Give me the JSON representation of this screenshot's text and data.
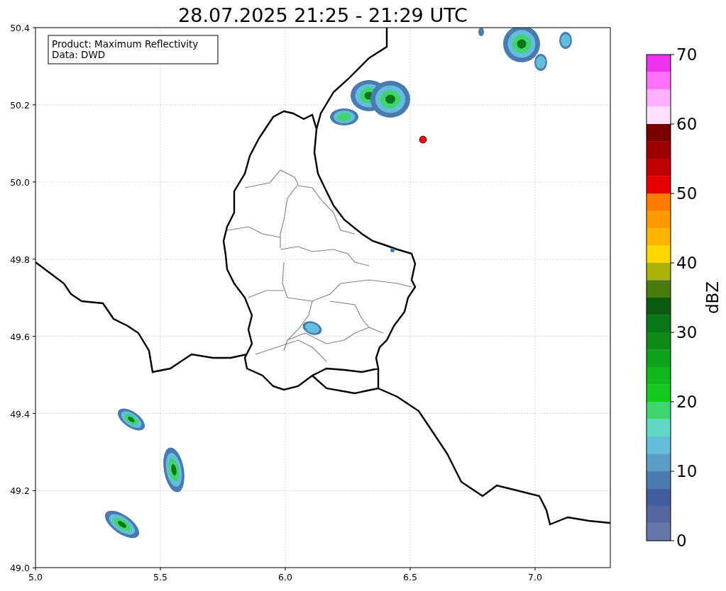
{
  "title": "28.07.2025 21:25 - 21:29 UTC",
  "info_box": {
    "lines": [
      "Product: Maximum Reflectivity",
      "Data: DWD"
    ]
  },
  "x_axis": {
    "ticks": [
      "5.0",
      "5.5",
      "6.0",
      "6.5",
      "7.0"
    ]
  },
  "y_axis": {
    "ticks": [
      "50.4",
      "50.2",
      "50.0",
      "49.8",
      "49.6",
      "49.4",
      "49.2",
      "49.0"
    ]
  },
  "colorbar": {
    "label": "dBZ",
    "ticks": [
      "70",
      "60",
      "50",
      "40",
      "30",
      "20",
      "10",
      "0"
    ],
    "segments": [
      {
        "color": "#f030f0"
      },
      {
        "color": "#ff70ff"
      },
      {
        "color": "#ffb0ff"
      },
      {
        "color": "#ffe0ff"
      },
      {
        "color": "#7a0000"
      },
      {
        "color": "#a00000"
      },
      {
        "color": "#c20000"
      },
      {
        "color": "#e60000"
      },
      {
        "color": "#ff7c00"
      },
      {
        "color": "#ff9a00"
      },
      {
        "color": "#ffb500"
      },
      {
        "color": "#ffd700"
      },
      {
        "color": "#aab20a"
      },
      {
        "color": "#4a7a0e"
      },
      {
        "color": "#0a5c12"
      },
      {
        "color": "#0b7616"
      },
      {
        "color": "#0d8a17"
      },
      {
        "color": "#0ea31a"
      },
      {
        "color": "#10b81a"
      },
      {
        "color": "#14c81f"
      },
      {
        "color": "#3fd46f"
      },
      {
        "color": "#62d6c5"
      },
      {
        "color": "#63bedb"
      },
      {
        "color": "#5b9ec6"
      },
      {
        "color": "#4a7ab0"
      },
      {
        "color": "#435d9e"
      },
      {
        "color": "#54679e"
      },
      {
        "color": "#6577a8"
      }
    ]
  }
}
